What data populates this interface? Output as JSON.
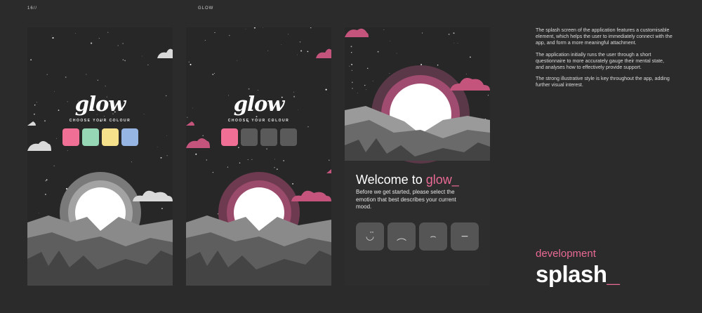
{
  "page": {
    "number": "16//",
    "project": "GLOW"
  },
  "screens": [
    {
      "id": "splash-default",
      "logo": "glow",
      "choose_label": "CHOOSE YOUR COLOUR",
      "swatch_colors": [
        "#ef6f95",
        "#96d8b6",
        "#f5e08b",
        "#96b5e2"
      ],
      "accent": "#9a9a9a",
      "cloud": "#d9d9d9"
    },
    {
      "id": "splash-selected",
      "logo": "glow",
      "choose_label": "CHOOSE YOUR COLOUR",
      "swatch_colors": [
        "#ef6f95",
        "#5a5a5a",
        "#5a5a5a",
        "#5a5a5a"
      ],
      "accent": "#c0547a",
      "cloud": "#c4547c"
    },
    {
      "id": "welcome",
      "welcome_prefix": "Welcome to ",
      "welcome_highlight": "glow_",
      "intro": "Before we get started, please select the emotion that best describes your current mood.",
      "mood_icons": [
        "smile-icon",
        "sad-icon",
        "upset-icon",
        "neutral-icon"
      ],
      "mood_glyphs": [
        "◡̈",
        "︵",
        "⌢",
        "−"
      ]
    }
  ],
  "description": [
    "The splash screen of the application features a customisable element, which helps the user to immediately connect with the app, and form a more meaningful attachment.",
    "The application initially runs the user through a short questionnaire to more accurately gauge their mental state, and analyses how to effectively provide support.",
    "The strong illustrative style is key throughout the app, adding further visual interest."
  ],
  "section_label": "development",
  "section_title": "splash",
  "section_title_cursor": "_",
  "colors": {
    "background": "#2b2b2b",
    "accent_pink": "#e96a93",
    "text": "#ffffff"
  }
}
